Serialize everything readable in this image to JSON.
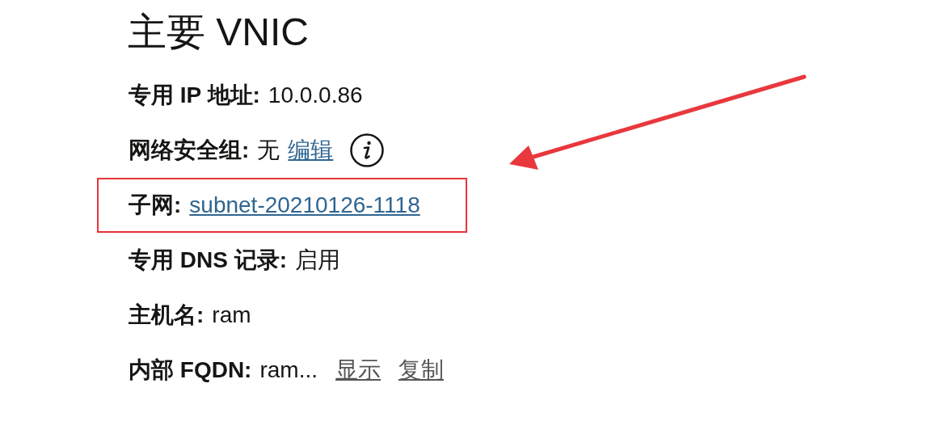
{
  "title": "主要 VNIC",
  "fields": [
    {
      "label": "专用 IP 地址:",
      "value": "10.0.0.86",
      "info": false,
      "highlighted": false
    },
    {
      "label": "网络安全组:",
      "value": "无",
      "links": [
        {
          "text": "编辑",
          "kind": "primary"
        }
      ],
      "info": true,
      "highlighted": false
    },
    {
      "label": "子网:",
      "links": [
        {
          "text": "subnet-20210126-1118",
          "kind": "primary"
        }
      ],
      "info": false,
      "highlighted": true
    },
    {
      "label": "专用 DNS 记录:",
      "value": "启用",
      "info": false,
      "highlighted": false
    },
    {
      "label": "主机名:",
      "value": "ram",
      "info": false,
      "highlighted": false
    },
    {
      "label": "内部 FQDN:",
      "value": "ram...",
      "links": [
        {
          "text": "显示",
          "kind": "muted"
        },
        {
          "text": "复制",
          "kind": "muted"
        }
      ],
      "info": false,
      "highlighted": false
    }
  ]
}
